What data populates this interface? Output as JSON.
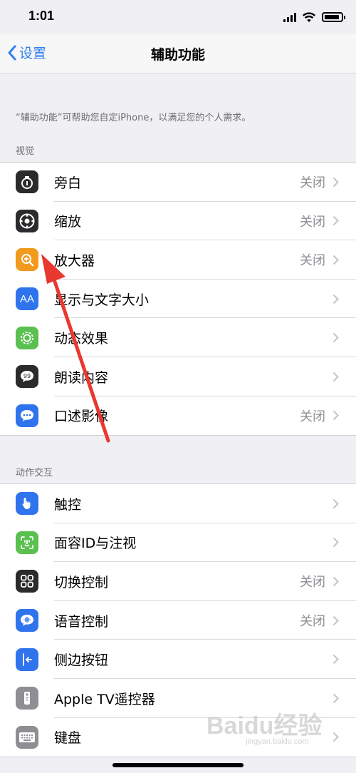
{
  "status_bar": {
    "time": "1:01"
  },
  "nav": {
    "back_label": "设置",
    "title": "辅助功能"
  },
  "description": "“辅助功能”可帮助您自定iPhone，以满足您的个人需求。",
  "sections": [
    {
      "header": "视觉",
      "items": [
        {
          "label": "旁白",
          "value": "关闭",
          "icon": "voiceover-icon",
          "color": "#2b2b2d"
        },
        {
          "label": "缩放",
          "value": "关闭",
          "icon": "zoom-icon",
          "color": "#2b2b2d"
        },
        {
          "label": "放大器",
          "value": "关闭",
          "icon": "magnifier-icon",
          "color": "#f19a1d"
        },
        {
          "label": "显示与文字大小",
          "value": "",
          "icon": "text-size-icon",
          "color": "#2f74ed"
        },
        {
          "label": "动态效果",
          "value": "",
          "icon": "motion-icon",
          "color": "#5ac04f"
        },
        {
          "label": "朗读内容",
          "value": "",
          "icon": "spoken-content-icon",
          "color": "#2b2b2d"
        },
        {
          "label": "口述影像",
          "value": "关闭",
          "icon": "audio-description-icon",
          "color": "#2f74ed"
        }
      ]
    },
    {
      "header": "动作交互",
      "items": [
        {
          "label": "触控",
          "value": "",
          "icon": "touch-icon",
          "color": "#2f74ed"
        },
        {
          "label": "面容ID与注视",
          "value": "",
          "icon": "face-id-icon",
          "color": "#5ac04f"
        },
        {
          "label": "切换控制",
          "value": "关闭",
          "icon": "switch-control-icon",
          "color": "#2b2b2d"
        },
        {
          "label": "语音控制",
          "value": "关闭",
          "icon": "voice-control-icon",
          "color": "#2f74ed"
        },
        {
          "label": "侧边按钮",
          "value": "",
          "icon": "side-button-icon",
          "color": "#2f74ed"
        },
        {
          "label": "Apple TV遥控器",
          "value": "",
          "icon": "apple-tv-remote-icon",
          "color": "#8e8e93"
        },
        {
          "label": "键盘",
          "value": "",
          "icon": "keyboard-icon",
          "color": "#8e8e93"
        }
      ]
    }
  ],
  "watermark": {
    "text": "Baidu经验",
    "sub": "jingyan.baidu.com"
  },
  "colors": {
    "accent": "#2f7ff4",
    "annotation_arrow": "#e8382f"
  }
}
